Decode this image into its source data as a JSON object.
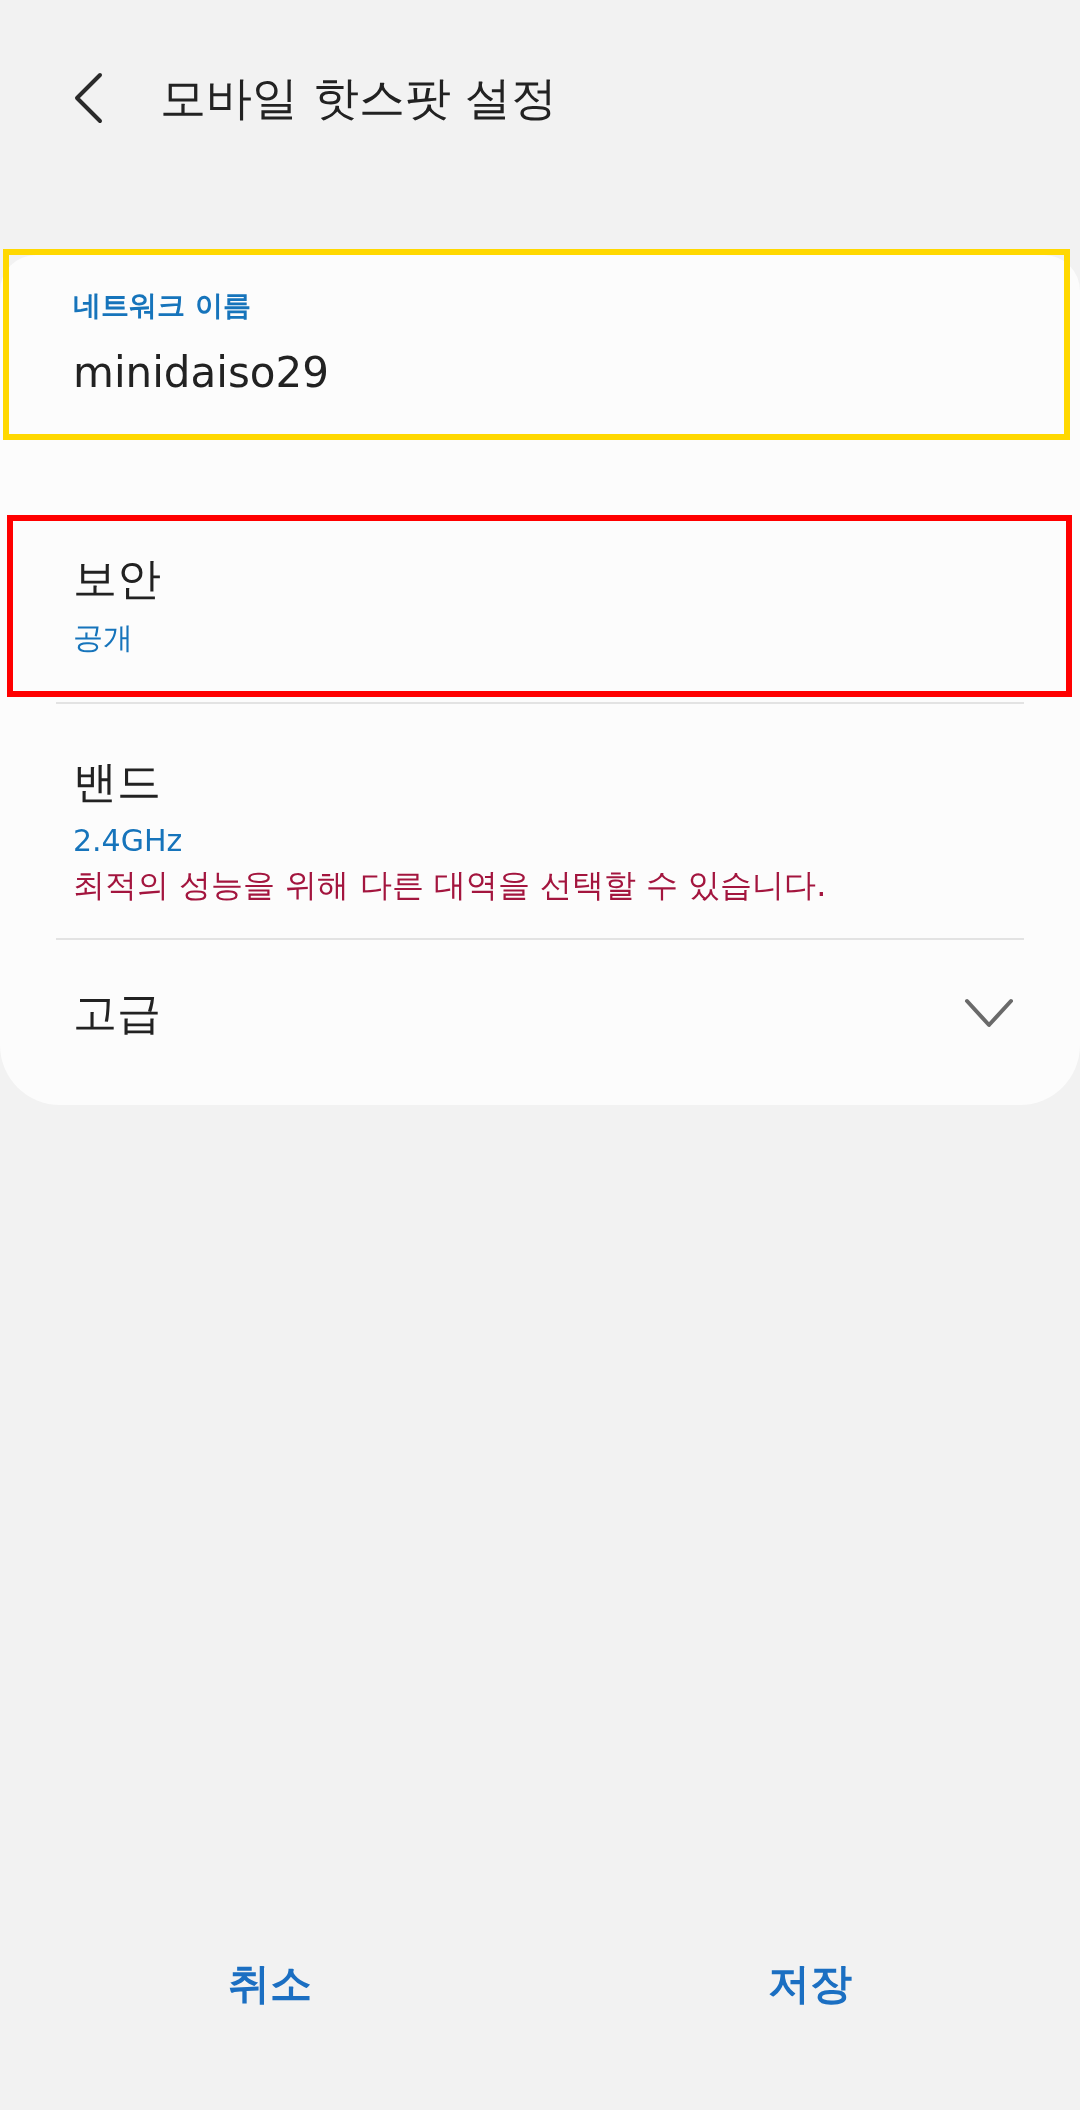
{
  "header": {
    "title": "모바일 핫스팟 설정"
  },
  "settings": [
    {
      "kind": "field",
      "label": "네트워크 이름",
      "value": "minidaiso29",
      "color": "#ffd800"
    },
    {
      "kind": "option",
      "title": "보안",
      "value": "공개",
      "color": "#ff0000"
    },
    {
      "kind": "option",
      "title": "밴드",
      "value": "2.4GHz",
      "note": "최적의 성능을 위해 다른 대역을 선택할 수 있습니다."
    },
    {
      "kind": "expander",
      "title": "고급",
      "expanded": false
    }
  ],
  "buttons": [
    {
      "label": "취소"
    },
    {
      "label": "저장"
    }
  ]
}
